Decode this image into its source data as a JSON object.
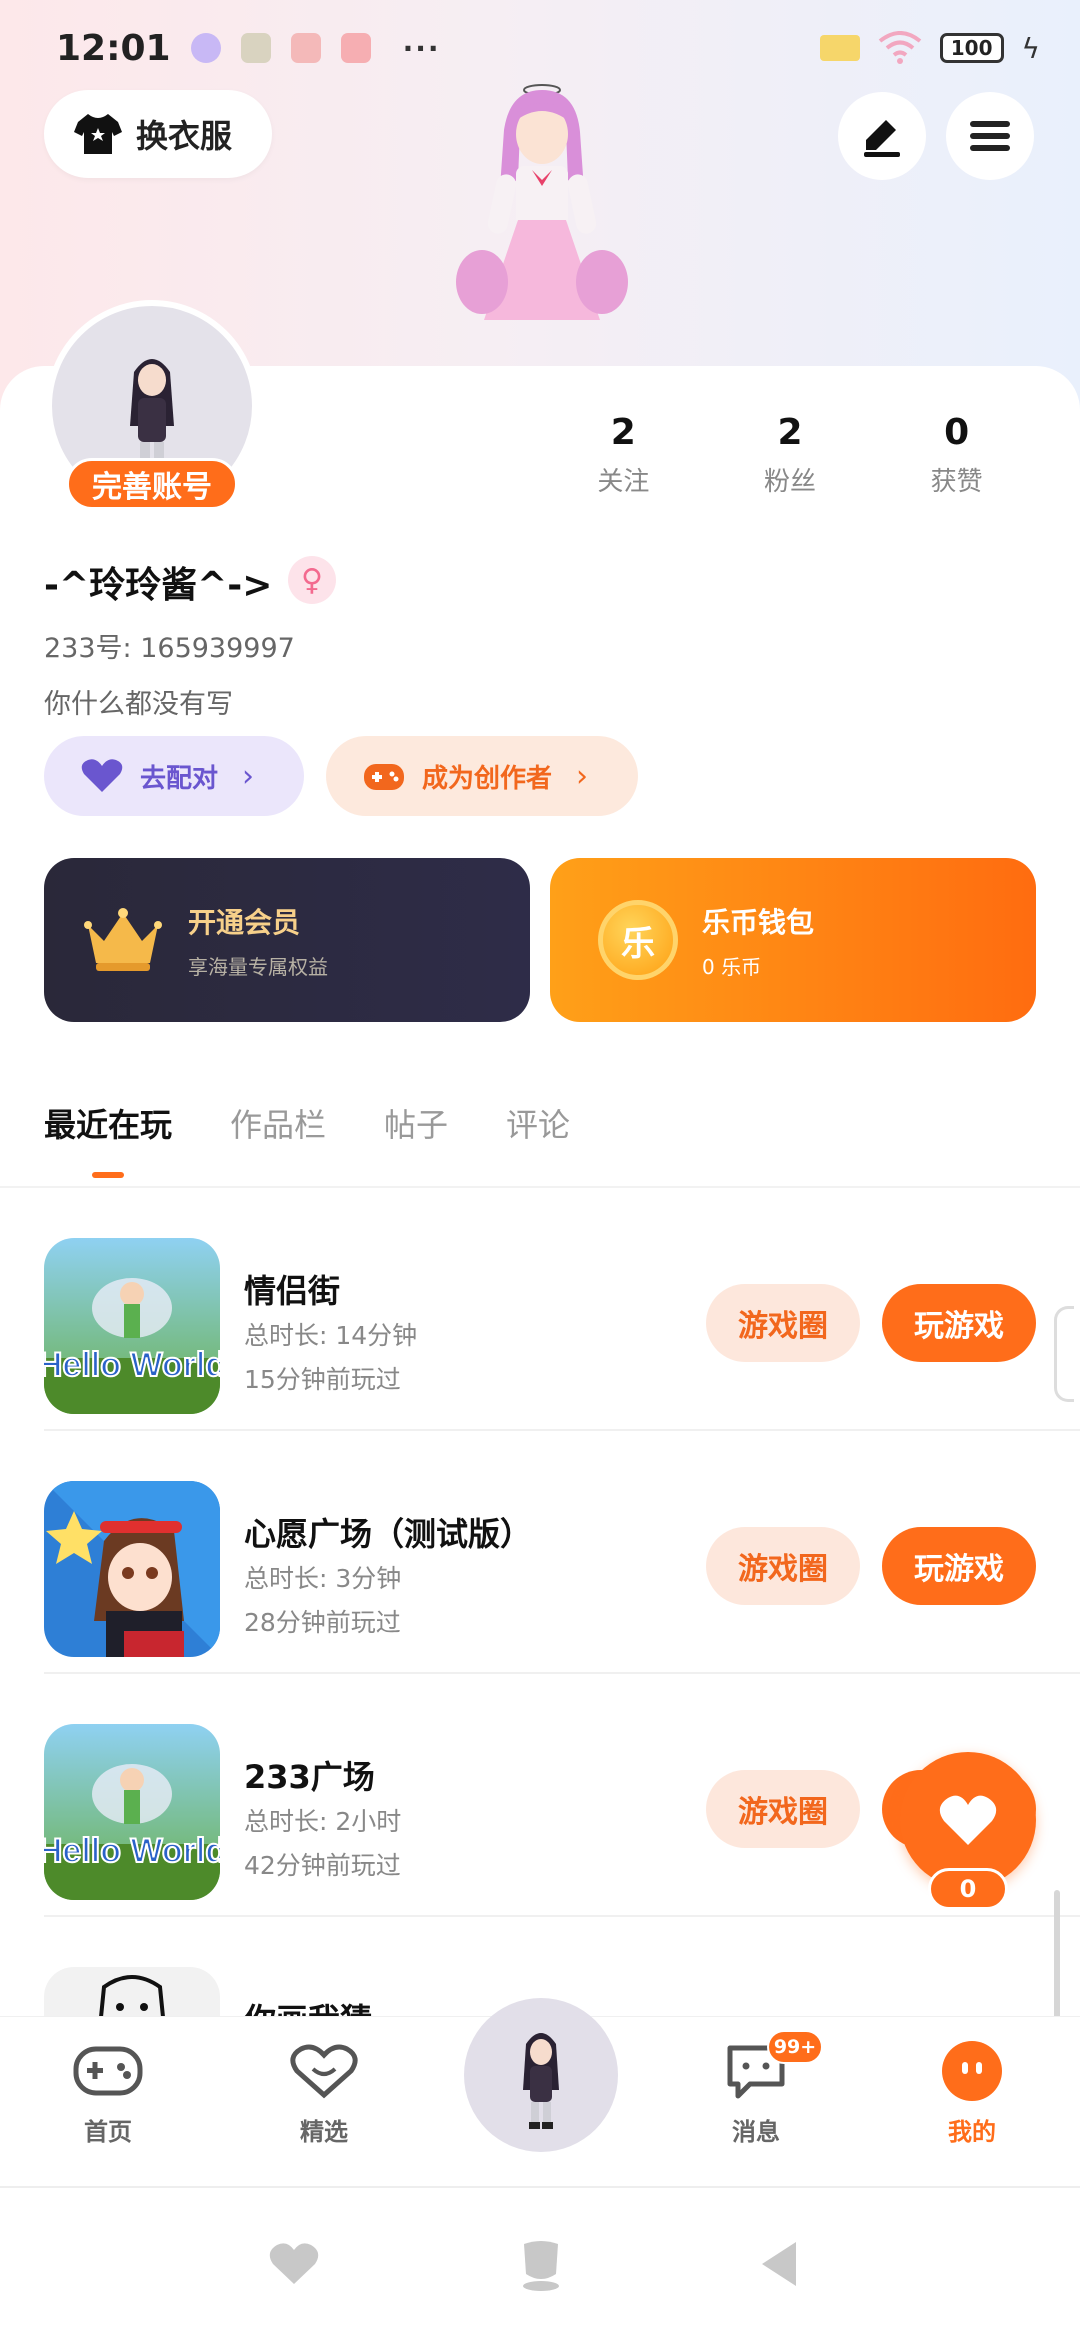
{
  "status_bar": {
    "time": "12:01",
    "battery": "100",
    "more": "···"
  },
  "header": {
    "dress_up_label": "换衣服"
  },
  "profile": {
    "complete_account_label": "完善账号",
    "nickname": "-^玲玲酱^->",
    "gender_symbol": "♀",
    "uid": "233号: 165939997",
    "bio": "你什么都没有写",
    "stats": [
      {
        "value": "2",
        "label": "关注"
      },
      {
        "value": "2",
        "label": "粉丝"
      },
      {
        "value": "0",
        "label": "获赞"
      }
    ],
    "match_label": "去配对",
    "creator_label": "成为创作者"
  },
  "cards": {
    "vip": {
      "title": "开通会员",
      "subtitle": "享海量专属权益"
    },
    "wallet": {
      "title": "乐币钱包",
      "subtitle": "0 乐币",
      "coin_glyph": "乐"
    }
  },
  "tabs": [
    {
      "label": "最近在玩",
      "active": true
    },
    {
      "label": "作品栏",
      "active": false
    },
    {
      "label": "帖子",
      "active": false
    },
    {
      "label": "评论",
      "active": false
    }
  ],
  "games": [
    {
      "name": "情侣街",
      "duration": "总时长: 14分钟",
      "last_played": "15分钟前玩过",
      "circle_label": "游戏圈",
      "play_label": "玩游戏",
      "thumb_text": "Hello World"
    },
    {
      "name": "心愿广场（测试版）",
      "duration": "总时长: 3分钟",
      "last_played": "28分钟前玩过",
      "circle_label": "游戏圈",
      "play_label": "玩游戏",
      "thumb_text": ""
    },
    {
      "name": "233广场",
      "duration": "总时长: 2小时",
      "last_played": "42分钟前玩过",
      "circle_label": "游戏圈",
      "play_label": "",
      "thumb_text": "Hello World"
    },
    {
      "name": "你画我猜",
      "duration": "",
      "last_played": "",
      "circle_label": "",
      "play_label": "",
      "thumb_text": ""
    }
  ],
  "fab": {
    "count": "0"
  },
  "bottom_nav": [
    {
      "label": "首页",
      "icon": "gamepad-icon"
    },
    {
      "label": "精选",
      "icon": "heart-chat-icon"
    },
    {
      "label": "消息",
      "icon": "message-icon",
      "badge": "99+"
    },
    {
      "label": "我的",
      "icon": "face-icon",
      "active": true
    }
  ],
  "colors": {
    "accent": "#ff6d1a",
    "vip_bg": "#2a2839",
    "match_bg": "#ebe6fb"
  }
}
